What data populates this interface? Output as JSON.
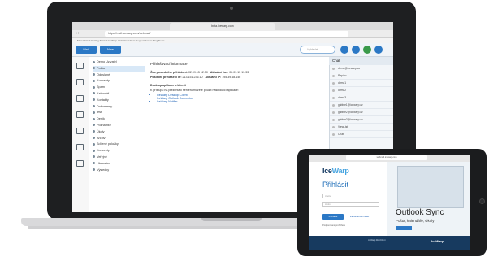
{
  "browser": {
    "tab_title": "beta.icewarp.com",
    "url": "https://mail.icewarp.com/webmail/",
    "bookmarks": "Most Visited   Getting Started   IceWarp   WebClient   Docs   Support   Forum   Blog   News"
  },
  "toolbar": {
    "mail_label": "Mail",
    "new_label": "New",
    "search_placeholder": "Vyhledat"
  },
  "tree": {
    "items": [
      {
        "label": "Demo Uzivatel",
        "selected": false
      },
      {
        "label": "Pošta",
        "selected": true
      },
      {
        "label": "Odeslané",
        "selected": false
      },
      {
        "label": "Koncepty",
        "selected": false
      },
      {
        "label": "Spam",
        "selected": false
      },
      {
        "label": "Kalendář",
        "selected": false
      },
      {
        "label": "Kontakty",
        "selected": false
      },
      {
        "label": "Dokumenty",
        "selected": false
      },
      {
        "label": "test",
        "selected": false
      },
      {
        "label": "Deník",
        "selected": false
      },
      {
        "label": "Poznámky",
        "selected": false
      },
      {
        "label": "Úkoly",
        "selected": false
      },
      {
        "label": "Archiv",
        "selected": false
      },
      {
        "label": "Sdílené položky",
        "selected": false
      },
      {
        "label": "Koncepty",
        "selected": false
      },
      {
        "label": "Veřejné",
        "selected": false
      },
      {
        "label": "Hlasování",
        "selected": false
      },
      {
        "label": "Výsledky",
        "selected": false
      }
    ]
  },
  "main": {
    "heading": "Přihlašovací informace",
    "row1_label": "Čas posledního přihlášení:",
    "row1_value": "02.09.15 12:50",
    "row1_label2": "Aktuální čas:",
    "row1_value2": "02.09.15 13:33",
    "row2_label": "Poslední přihlášení IP:",
    "row2_value": "213.151.236.10",
    "row2_label2": "Aktuální IP:",
    "row2_value2": "195.39.68.146",
    "apps_heading": "Desktop aplikace a klienti",
    "apps_intro": "K přístupu na prezentaci serveru můžete použít následující aplikace:",
    "links": [
      "IceWarp Desktop Client",
      "IceWarp Outlook Connector",
      "IceWarp Notifier"
    ]
  },
  "chat": {
    "title": "Chat",
    "items": [
      "demo@icewarp.cz",
      "Pepíno",
      "demo1",
      "demo2",
      "demo3",
      "gabbie1@icewarp.cz",
      "gabbie2@icewarp.cz",
      "gabbie3@icewarp.cz",
      "ViewList",
      "Chat"
    ]
  },
  "tablet": {
    "url": "webmail.icewarp.com",
    "logo_a": "Ice",
    "logo_b": "Warp",
    "title": "Přihlásit",
    "username_placeholder": "Jméno",
    "password_placeholder": "Heslo",
    "login_button": "Přihlásit",
    "forgot_link": "Zapomenuté heslo",
    "small_text": "Podporované prohlížeče",
    "promo_title": "Outlook Sync",
    "promo_sub": "Pošta, kalendáře, Úkoly",
    "footer_text": "IceWarp WebClient",
    "footer_logo": "IceWarp"
  }
}
